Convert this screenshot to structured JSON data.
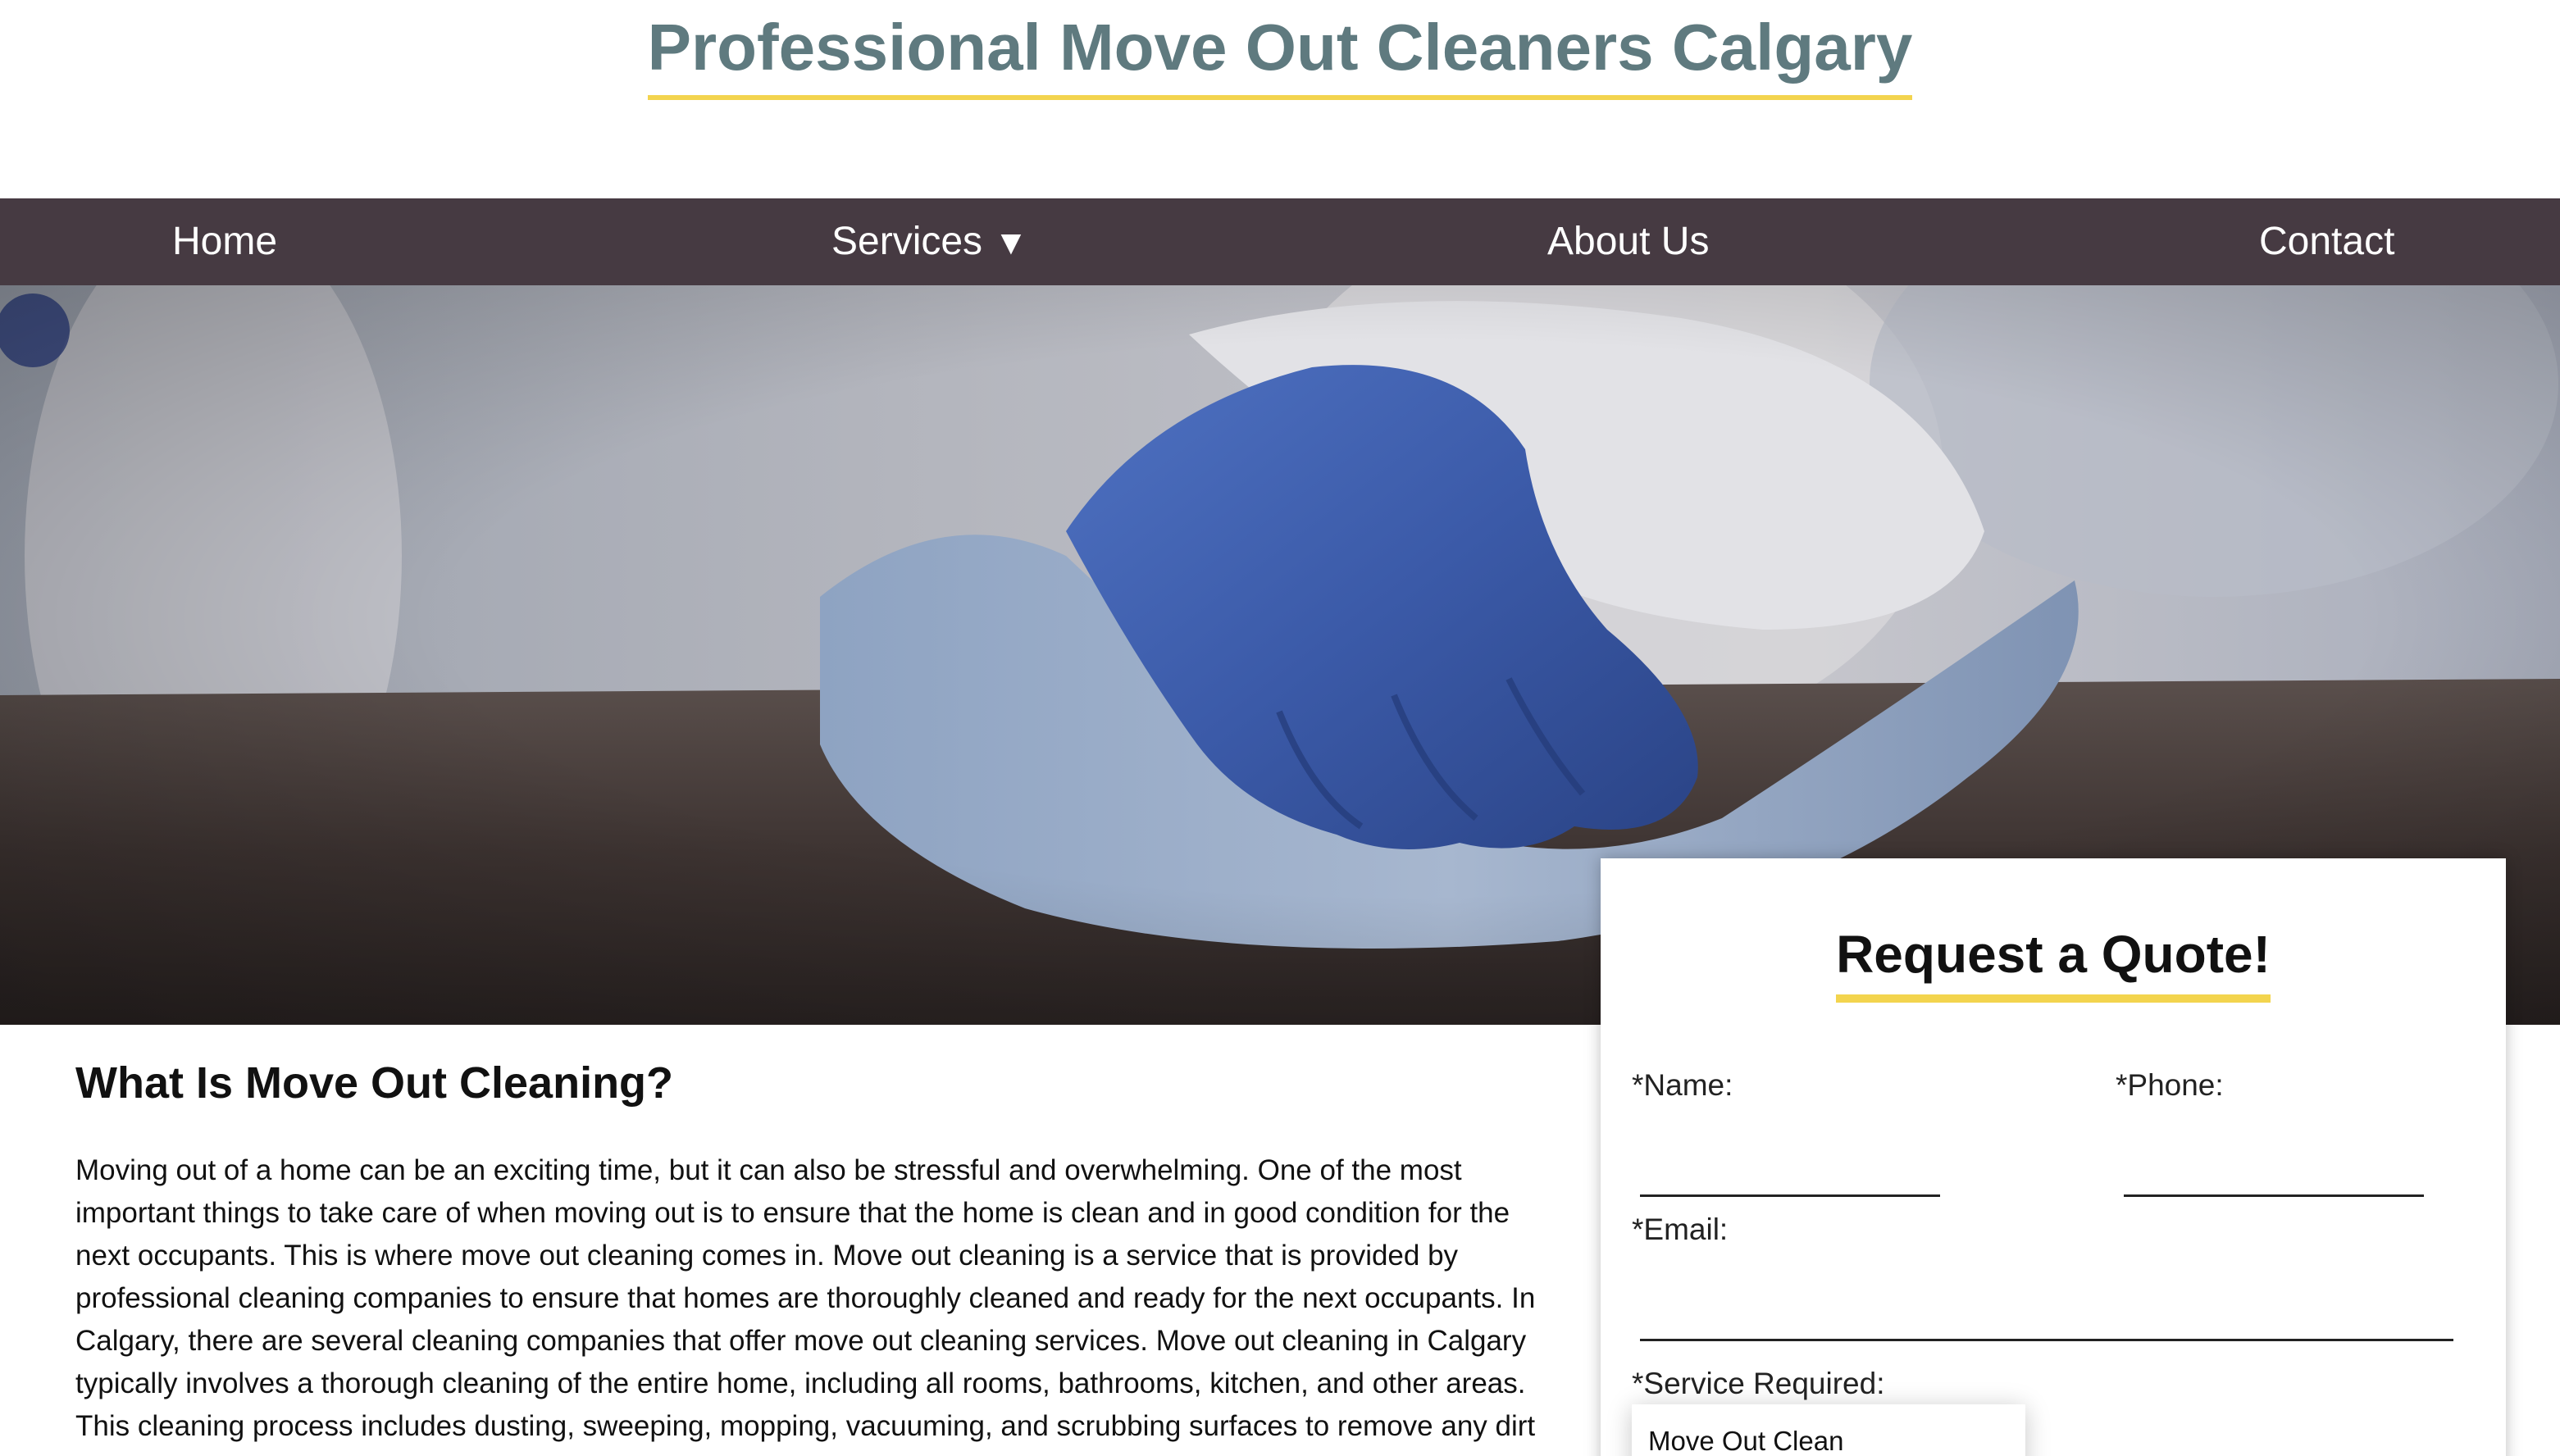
{
  "header": {
    "title": "Professional Move Out Cleaners Calgary"
  },
  "nav": {
    "items": [
      {
        "label": "Home"
      },
      {
        "label": "Services"
      },
      {
        "label": "About Us"
      },
      {
        "label": "Contact"
      }
    ],
    "services_caret": "▼"
  },
  "hero": {
    "image_subject": "gloved-hand-wiping-table"
  },
  "main": {
    "heading": "What Is Move Out Cleaning?",
    "paragraph": "Moving out of a home can be an exciting time, but it can also be stressful and overwhelming. One of the most important things to take care of when moving out is to ensure that the home is clean and in good condition for the next occupants. This is where move out cleaning comes in. Move out cleaning is a service that is provided by professional cleaning companies to ensure that homes are thoroughly cleaned and ready for the next occupants. In Calgary, there are several cleaning companies that offer move out cleaning services. Move out cleaning in Calgary typically involves a thorough cleaning of the entire home, including all rooms, bathrooms, kitchen, and other areas. This cleaning process includes dusting, sweeping, mopping, vacuuming, and scrubbing surfaces to remove any dirt"
  },
  "quote_form": {
    "title": "Request a Quote!",
    "name_label": "*Name:",
    "phone_label": "*Phone:",
    "email_label": "*Email:",
    "service_label": "*Service Required:",
    "service_selected": "Move Out Clean"
  },
  "colors": {
    "title": "#5f7a7f",
    "accent_underline": "#f3d44e",
    "nav_bg": "#463a42",
    "glove": "#3c5fae"
  }
}
